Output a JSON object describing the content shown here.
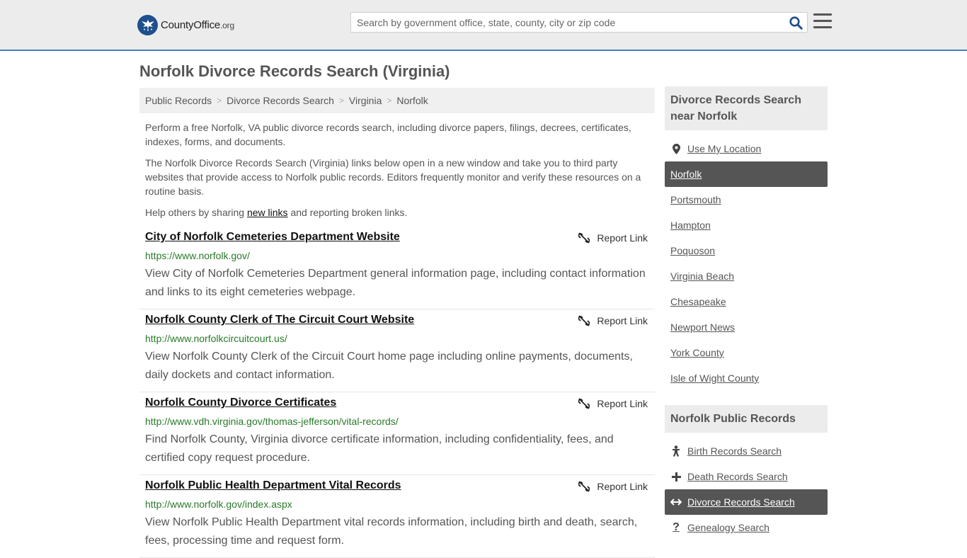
{
  "header": {
    "logo_main": "CountyOffice",
    "logo_suffix": ".org",
    "search_placeholder": "Search by government office, state, county, city or zip code"
  },
  "page_title": "Norfolk Divorce Records Search (Virginia)",
  "breadcrumb": [
    "Public Records",
    "Divorce Records Search",
    "Virginia",
    "Norfolk"
  ],
  "intro": {
    "p1": "Perform a free Norfolk, VA public divorce records search, including divorce papers, filings, decrees, certificates, indexes, forms, and documents.",
    "p2": "The Norfolk Divorce Records Search (Virginia) links below open in a new window and take you to third party websites that provide access to Norfolk public records. Editors frequently monitor and verify these resources on a routine basis.",
    "p3_before": "Help others by sharing ",
    "p3_link": "new links",
    "p3_after": " and reporting broken links."
  },
  "report_label": "Report Link",
  "results": [
    {
      "title": "City of Norfolk Cemeteries Department Website",
      "url": "https://www.norfolk.gov/",
      "desc": "View City of Norfolk Cemeteries Department general information page, including contact information and links to its eight cemeteries webpage."
    },
    {
      "title": "Norfolk County Clerk of The Circuit Court Website",
      "url": "http://www.norfolkcircuitcourt.us/",
      "desc": "View Norfolk County Clerk of the Circuit Court home page including online payments, documents, daily dockets and contact information."
    },
    {
      "title": "Norfolk County Divorce Certificates",
      "url": "http://www.vdh.virginia.gov/thomas-jefferson/vital-records/",
      "desc": "Find Norfolk County, Virginia divorce certificate information, including confidentiality, fees, and certified copy request procedure."
    },
    {
      "title": "Norfolk Public Health Department Vital Records",
      "url": "http://www.norfolk.gov/index.aspx",
      "desc": "View Norfolk Public Health Department vital records information, including birth and death, search, fees, processing time and request form."
    }
  ],
  "sidebar": {
    "nearby_heading": "Divorce Records Search near Norfolk",
    "use_location": "Use My Location",
    "nearby": [
      "Norfolk",
      "Portsmouth",
      "Hampton",
      "Poquoson",
      "Virginia Beach",
      "Chesapeake",
      "Newport News",
      "York County",
      "Isle of Wight County"
    ],
    "records_heading": "Norfolk Public Records",
    "records": [
      {
        "label": "Birth Records Search",
        "icon": "baby-icon"
      },
      {
        "label": "Death Records Search",
        "icon": "cross-icon"
      },
      {
        "label": "Divorce Records Search",
        "icon": "split-arrows-icon"
      },
      {
        "label": "Genealogy Search",
        "icon": "question-icon"
      }
    ]
  },
  "colors": {
    "header_bg": "#ececec",
    "header_border": "#4a7bb7",
    "active_bg": "#555555",
    "url_green": "#2a7a2a"
  }
}
